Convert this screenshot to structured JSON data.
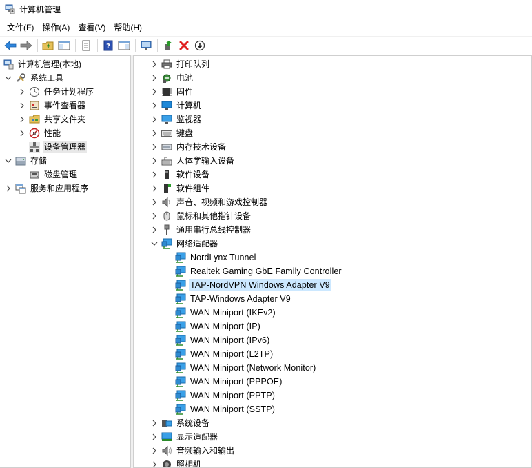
{
  "window": {
    "title": "计算机管理"
  },
  "menu": {
    "file": "文件(F)",
    "action": "操作(A)",
    "view": "查看(V)",
    "help": "帮助(H)"
  },
  "left_tree": {
    "root": "计算机管理(本地)",
    "system_tools": "系统工具",
    "task_scheduler": "任务计划程序",
    "event_viewer": "事件查看器",
    "shared_folders": "共享文件夹",
    "performance": "性能",
    "device_manager": "设备管理器",
    "storage": "存储",
    "disk_management": "磁盘管理",
    "services_apps": "服务和应用程序"
  },
  "devices": {
    "printer_queue": "打印队列",
    "battery": "电池",
    "firmware": "固件",
    "computer": "计算机",
    "monitors": "监视器",
    "keyboards": "键盘",
    "memory_tech": "内存技术设备",
    "hid": "人体学输入设备",
    "software_devices": "软件设备",
    "software_components": "软件组件",
    "sound": "声音、视频和游戏控制器",
    "mice": "鼠标和其他指针设备",
    "usb": "通用串行总线控制器",
    "network_adapters": "网络适配器",
    "system_devices": "系统设备",
    "display_adapters": "显示适配器",
    "audio_io": "音频输入和输出",
    "cameras": "照相机"
  },
  "network_children": [
    "NordLynx Tunnel",
    "Realtek Gaming GbE Family Controller",
    "TAP-NordVPN Windows Adapter V9",
    "TAP-Windows Adapter V9",
    "WAN Miniport (IKEv2)",
    "WAN Miniport (IP)",
    "WAN Miniport (IPv6)",
    "WAN Miniport (L2TP)",
    "WAN Miniport (Network Monitor)",
    "WAN Miniport (PPPOE)",
    "WAN Miniport (PPTP)",
    "WAN Miniport (SSTP)"
  ],
  "colors": {
    "selection_blue": "#cce8ff",
    "selection_gray": "#e8e8e8",
    "border": "#cfcfcf",
    "accent": "#1e78c8"
  }
}
